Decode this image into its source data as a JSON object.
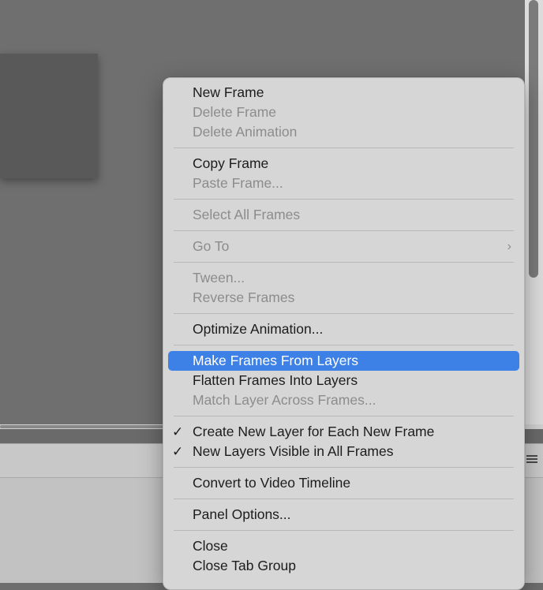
{
  "context_menu": {
    "groups": [
      {
        "items": [
          {
            "label": "New Frame",
            "enabled": true
          },
          {
            "label": "Delete Frame",
            "enabled": false
          },
          {
            "label": "Delete Animation",
            "enabled": false
          }
        ]
      },
      {
        "items": [
          {
            "label": "Copy Frame",
            "enabled": true
          },
          {
            "label": "Paste Frame...",
            "enabled": false
          }
        ]
      },
      {
        "items": [
          {
            "label": "Select All Frames",
            "enabled": false
          }
        ]
      },
      {
        "items": [
          {
            "label": "Go To",
            "enabled": false,
            "submenu": true,
            "submenu_glyph": "›"
          }
        ]
      },
      {
        "items": [
          {
            "label": "Tween...",
            "enabled": false
          },
          {
            "label": "Reverse Frames",
            "enabled": false
          }
        ]
      },
      {
        "items": [
          {
            "label": "Optimize Animation...",
            "enabled": true
          }
        ]
      },
      {
        "items": [
          {
            "label": "Make Frames From Layers",
            "enabled": true,
            "highlighted": true
          },
          {
            "label": "Flatten Frames Into Layers",
            "enabled": true
          },
          {
            "label": "Match Layer Across Frames...",
            "enabled": false
          }
        ]
      },
      {
        "items": [
          {
            "label": "Create New Layer for Each New Frame",
            "enabled": true,
            "checked": true,
            "check_glyph": "✓"
          },
          {
            "label": "New Layers Visible in All Frames",
            "enabled": true,
            "checked": true,
            "check_glyph": "✓"
          }
        ]
      },
      {
        "items": [
          {
            "label": "Convert to Video Timeline",
            "enabled": true
          }
        ]
      },
      {
        "items": [
          {
            "label": "Panel Options...",
            "enabled": true
          }
        ]
      },
      {
        "items": [
          {
            "label": "Close",
            "enabled": true
          },
          {
            "label": "Close Tab Group",
            "enabled": true
          }
        ]
      }
    ]
  },
  "colors": {
    "highlight": "#3d80e6",
    "enabled_text": "#1c1c1c",
    "disabled_text": "#8c8c8c",
    "menu_background": "#d6d6d6"
  },
  "icons": {
    "panel_menu": "hamburger-icon"
  }
}
